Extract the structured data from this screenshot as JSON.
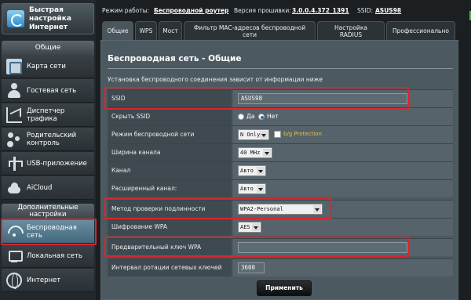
{
  "sidebar": {
    "quick_setup_label": "Быстрая настройка Интернет",
    "general_header": "Общие",
    "general_items": [
      {
        "label": "Карта сети",
        "icon": "network-map-icon"
      },
      {
        "label": "Гостевая сеть",
        "icon": "guest-network-icon"
      },
      {
        "label": "Диспетчер трафика",
        "icon": "traffic-manager-icon"
      },
      {
        "label": "Родительский контроль",
        "icon": "parental-control-icon"
      },
      {
        "label": "USB-приложение",
        "icon": "usb-icon"
      },
      {
        "label": "AiCloud",
        "icon": "cloud-icon"
      }
    ],
    "advanced_header": "Дополнительные настройки",
    "advanced_items": [
      {
        "label": "Беспроводная сеть",
        "icon": "wifi-icon",
        "active": true
      },
      {
        "label": "Локальная сеть",
        "icon": "lan-icon"
      },
      {
        "label": "Интернет",
        "icon": "globe-icon"
      }
    ]
  },
  "topbar": {
    "mode_label": "Режим работы:",
    "mode_value": "Беспроводной роутер",
    "firmware_label": "Версия прошивки:",
    "firmware_value": "3.0.0.4.372_1391",
    "ssid_label": "SSID:",
    "ssid_value": "ASUS98"
  },
  "tabs": [
    "Общие",
    "WPS",
    "Мост",
    "Фильтр MAC-адресов беспроводной сети",
    "Настройка RADIUS",
    "Профессионально"
  ],
  "page": {
    "title": "Беспроводная сеть - Общие",
    "description": "Установка беспроводного соединения зависит от информации ниже"
  },
  "form": {
    "ssid_label": "SSID",
    "ssid_value": "ASUS98",
    "hide_ssid_label": "Скрыть SSID",
    "hide_yes": "Да",
    "hide_no": "Нет",
    "wireless_mode_label": "Режим беспроводной сети",
    "wireless_mode_value": "N Only",
    "bg_protection_label": "b/g Protection",
    "channel_width_label": "Ширина канала",
    "channel_width_value": "40 MHz",
    "channel_label": "Канал",
    "channel_value": "Авто",
    "ext_channel_label": "Расширенный канал:",
    "ext_channel_value": "Авто",
    "auth_method_label": "Метод проверки подлинности",
    "auth_method_value": "WPA2-Personal",
    "wpa_encryption_label": "Шифрование WPA",
    "wpa_encryption_value": "AES",
    "psk_label": "Предварительный ключ WPA",
    "psk_value": "",
    "key_rotation_label": "Интервал ротации сетевых ключей",
    "key_rotation_value": "3600",
    "apply_label": "Применить"
  },
  "colors": {
    "highlight": "#d8262f",
    "panel": "#4d5960",
    "protection_text": "#f0c03c"
  }
}
